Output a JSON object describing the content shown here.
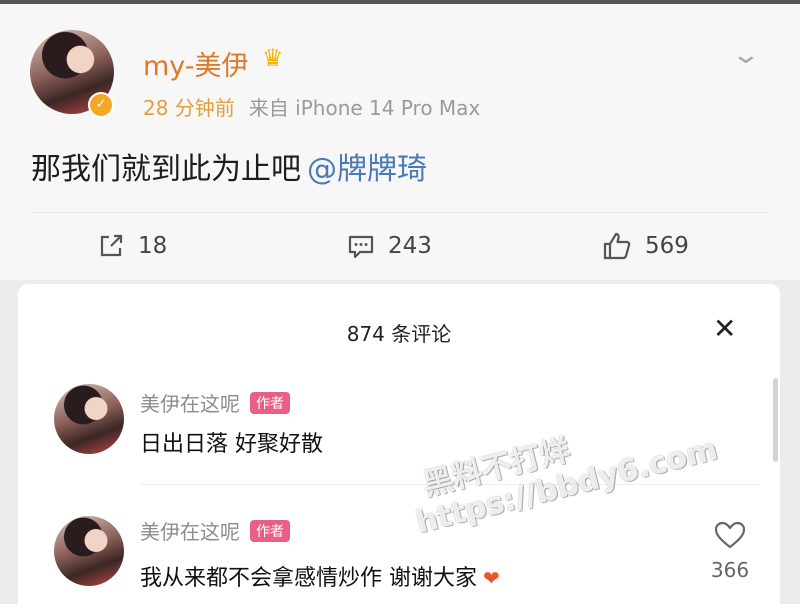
{
  "post": {
    "username": "my-美伊",
    "crown_icon": "crown-icon",
    "time": "28 分钟前",
    "source": "来自 iPhone 14 Pro Max",
    "text": "那我们就到此为止吧",
    "mention": "@牌牌琦",
    "actions": {
      "repost_count": "18",
      "comment_count": "243",
      "like_count": "569"
    }
  },
  "comments_sheet": {
    "title": "874 条评论",
    "close_label": "✕",
    "comments": [
      {
        "author": "美伊在这呢",
        "badge": "作者",
        "text": "日出日落 好聚好散"
      },
      {
        "author": "美伊在这呢",
        "badge": "作者",
        "text": "我从来都不会拿感情炒作 谢谢大家",
        "emoji": "❤",
        "like_count": "366"
      }
    ]
  },
  "watermark": {
    "line1": "黑料不打烊",
    "line2": "https://bbdy6.com"
  },
  "colors": {
    "username": "#e0782a",
    "mention": "#4a7bb8",
    "badge": "#ea5f85",
    "time": "#e3a03a"
  }
}
